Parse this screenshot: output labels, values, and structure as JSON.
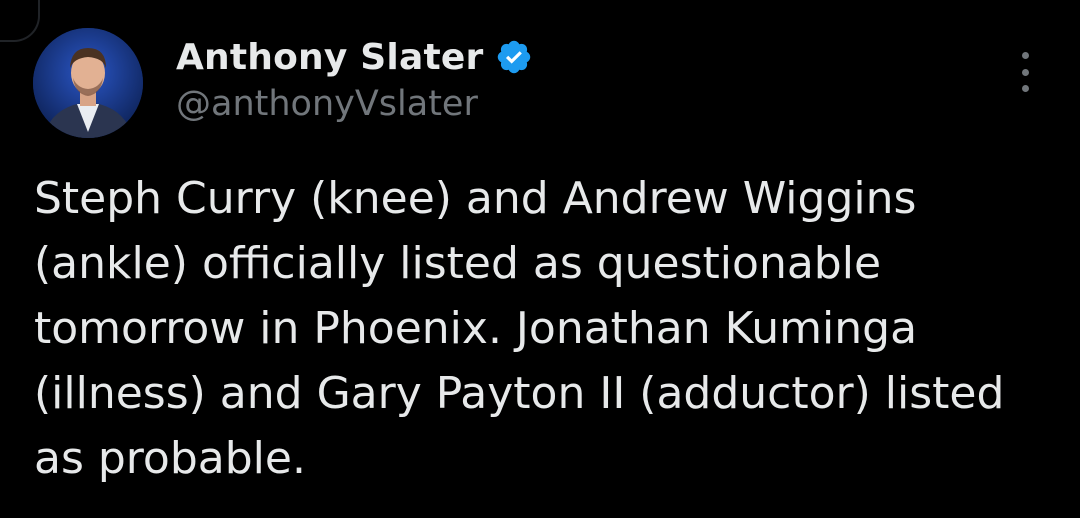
{
  "tweet": {
    "author": {
      "display_name": "Anthony Slater",
      "handle": "@anthonyVslater",
      "verified": true,
      "avatar_icon": "avatar-photo"
    },
    "text": "Steph Curry (knee) and Andrew Wiggins\n(ankle) officially listed as questionable\ntomorrow in Phoenix. Jonathan Kuminga\n(illness) and Gary Payton II (adductor) listed\nas probable.",
    "more_icon": "more-vertical-icon"
  },
  "colors": {
    "background": "#000000",
    "text_primary": "#e7e9ea",
    "text_secondary": "#71767b",
    "verified_badge": "#1d9bf0"
  }
}
